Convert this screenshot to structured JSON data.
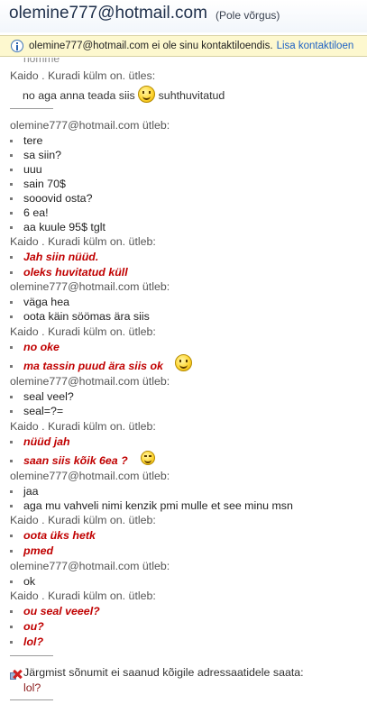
{
  "header": {
    "contact_email": "olemine777@hotmail.com",
    "status": "(Pole võrgus)"
  },
  "infobar": {
    "text": "olemine777@hotmail.com ei ole sinu kontaktiloendis.",
    "link": "Lisa kontaktiloen"
  },
  "chat": {
    "clipped_line": "nomme",
    "sender_kaido": "Kaido   .   Kuradi külm on. ütles:",
    "sender_kaido_utleb": "Kaido   .   Kuradi külm on. ütleb:",
    "sender_ole": "olemine777@hotmail.com ütleb:",
    "first_line": "no aga anna teada siis",
    "first_line_tail": "suhthuvitatud",
    "block1": [
      "tere",
      "sa siin?",
      "uuu",
      "sain 70$",
      "sooovid osta?",
      "6 ea!",
      "aa kuule 95$ tglt"
    ],
    "block2": [
      "Jah siin nüüd.",
      "oleks huvitatud küll"
    ],
    "block3": [
      "väga hea",
      "oota käin söömas ära siis"
    ],
    "block4": [
      "no oke",
      "ma tassin puud ära siis ok"
    ],
    "block5": [
      "seal veel?",
      "seal=?="
    ],
    "block6": [
      "nüüd jah",
      "saan siis kõik 6ea ?"
    ],
    "block7": [
      "jaa",
      "aga mu vahveli nimi kenzik pmi mulle  et see minu msn"
    ],
    "block8": [
      "oota üks hetk",
      "pmed"
    ],
    "block9": [
      "ok"
    ],
    "block10": [
      "ou seal veeel?",
      "ou?",
      "lol?"
    ]
  },
  "error": {
    "text": "Järgmist sõnumit ei saanud kõigile adressaatidele saata:",
    "message": "lol?"
  },
  "icons": [
    "info-icon",
    "smiley-emoticon",
    "wink-emoticon",
    "send-error-icon"
  ],
  "colors": {
    "kaido_text": "#c00000",
    "link": "#1f62c4",
    "infobar_bg": "#fdf8cf"
  }
}
